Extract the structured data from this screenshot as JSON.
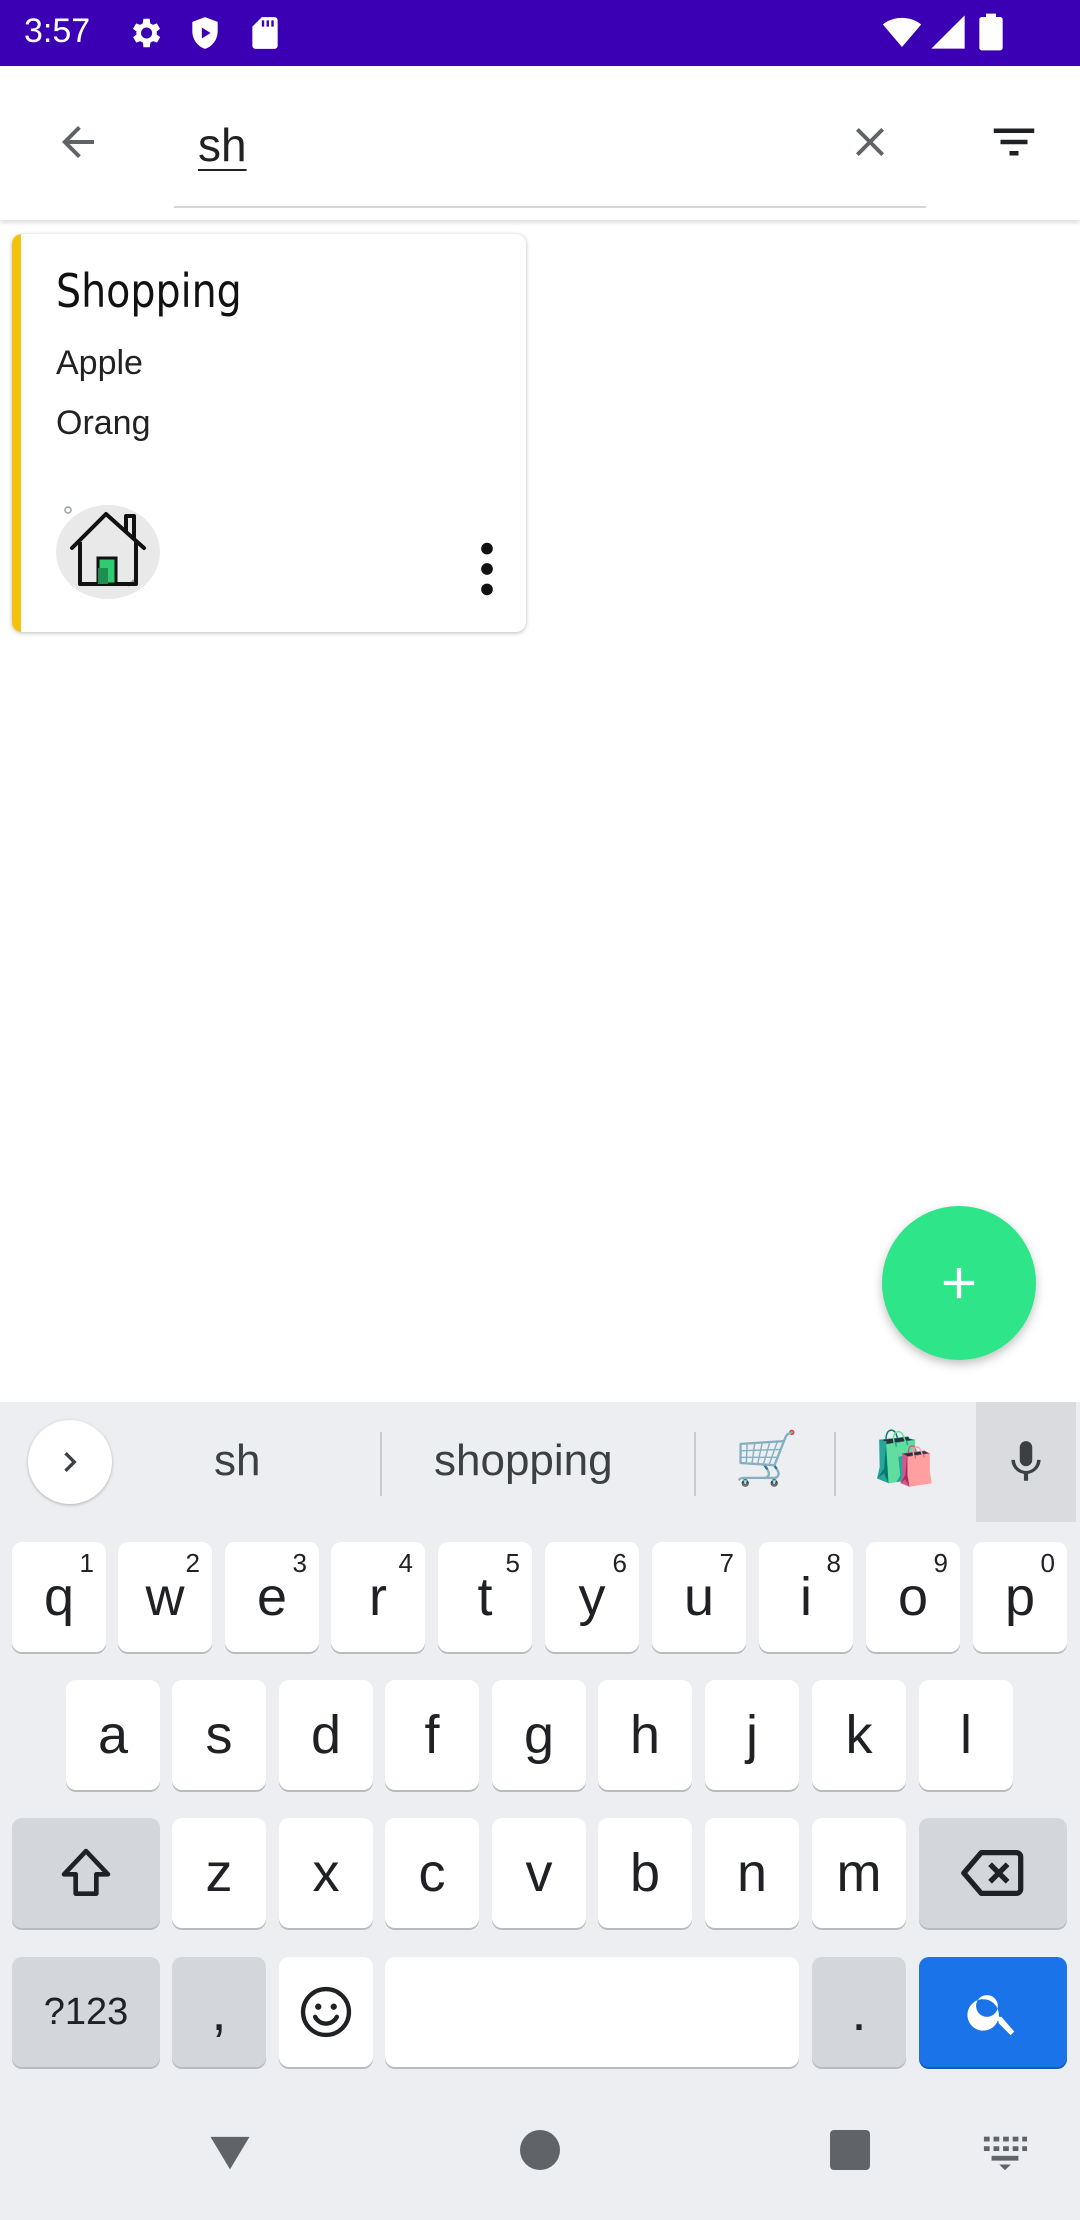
{
  "status_bar": {
    "time": "3:57",
    "icons": [
      "settings-gear-icon",
      "shield-icon",
      "sd-card-icon",
      "wifi-icon",
      "signal-icon",
      "battery-icon"
    ]
  },
  "toolbar": {
    "back_icon": "arrow-left-icon",
    "search_value": "sh",
    "clear_icon": "close-icon",
    "filter_icon": "filter-icon"
  },
  "notes": [
    {
      "title": "Shopping",
      "items": [
        "Apple",
        "Orang"
      ],
      "accent_color": "#f4c20d",
      "label_icon": "home-icon",
      "menu_icon": "more-vert-icon"
    }
  ],
  "fab": {
    "icon": "plus-icon",
    "color": "#2ee58a"
  },
  "keyboard": {
    "suggestions": [
      "sh",
      "shopping",
      "🛒",
      "🛍️"
    ],
    "row1": [
      {
        "k": "q",
        "h": "1"
      },
      {
        "k": "w",
        "h": "2"
      },
      {
        "k": "e",
        "h": "3"
      },
      {
        "k": "r",
        "h": "4"
      },
      {
        "k": "t",
        "h": "5"
      },
      {
        "k": "y",
        "h": "6"
      },
      {
        "k": "u",
        "h": "7"
      },
      {
        "k": "i",
        "h": "8"
      },
      {
        "k": "o",
        "h": "9"
      },
      {
        "k": "p",
        "h": "0"
      }
    ],
    "row2": [
      "a",
      "s",
      "d",
      "f",
      "g",
      "h",
      "j",
      "k",
      "l"
    ],
    "row3": [
      "z",
      "x",
      "c",
      "v",
      "b",
      "n",
      "m"
    ],
    "row4": {
      "symbols": "?123",
      "comma": ",",
      "period": "."
    },
    "accent_color": "#1a73e8"
  },
  "colors": {
    "status_bar": "#3b00b3",
    "background": "#ffffff"
  }
}
